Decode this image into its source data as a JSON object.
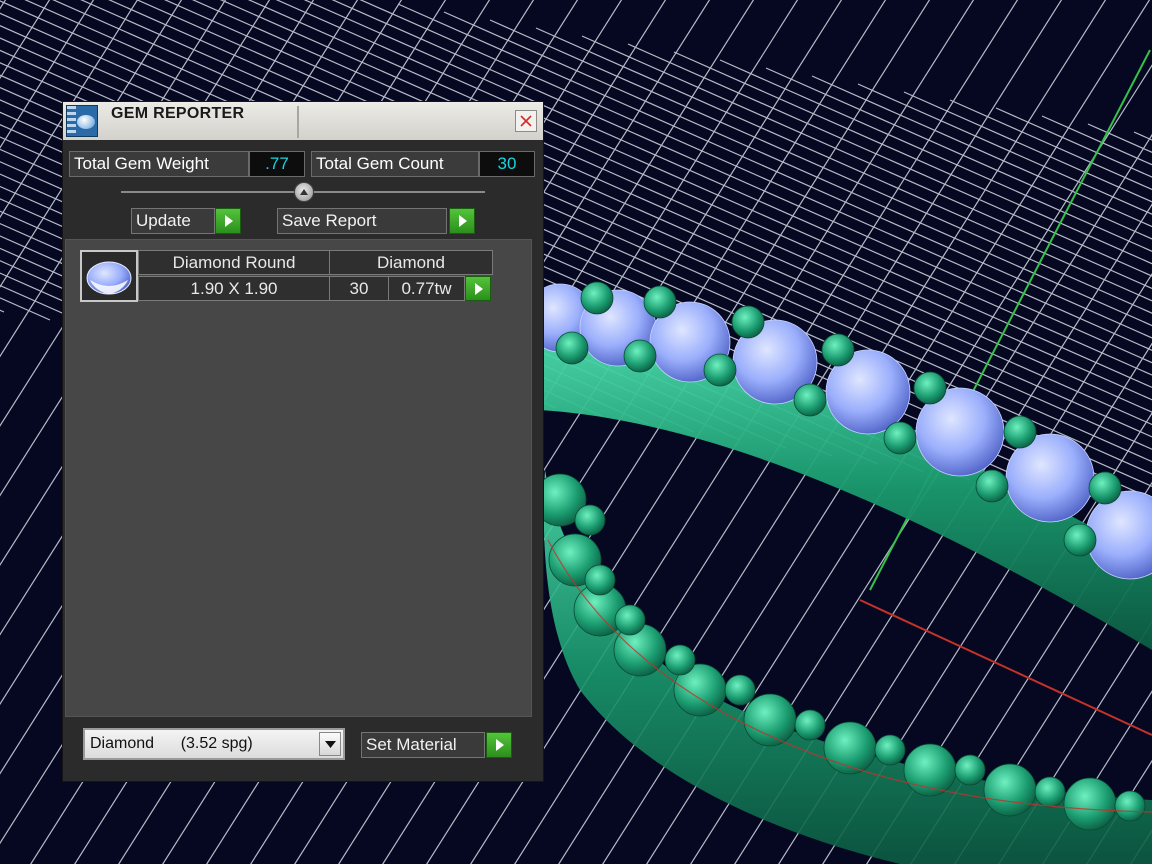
{
  "window": {
    "title": "GEM REPORTER",
    "close_label": "×"
  },
  "summary": {
    "weight_label": "Total Gem Weight",
    "weight_value": ".77",
    "count_label": "Total Gem Count",
    "count_value": "30"
  },
  "actions": {
    "update_label": "Update",
    "save_report_label": "Save Report"
  },
  "gem_list": [
    {
      "icon": "round-gem-icon",
      "shape": "Diamond Round",
      "material": "Diamond",
      "size": "1.90 X 1.90",
      "count": "30",
      "weight": "0.77tw"
    }
  ],
  "material": {
    "selected": "Diamond      (3.52 spg)",
    "set_label": "Set Material"
  },
  "colors": {
    "background": "#050820",
    "grid_lines": "#d6dbe6",
    "axis_green": "#33c24a",
    "axis_red": "#c4322a",
    "prong_metal": "#1c9e72",
    "gem_blue": "#9aaefc",
    "value_cyan": "#19d3e0",
    "go_button_green": "#3aa82a"
  }
}
